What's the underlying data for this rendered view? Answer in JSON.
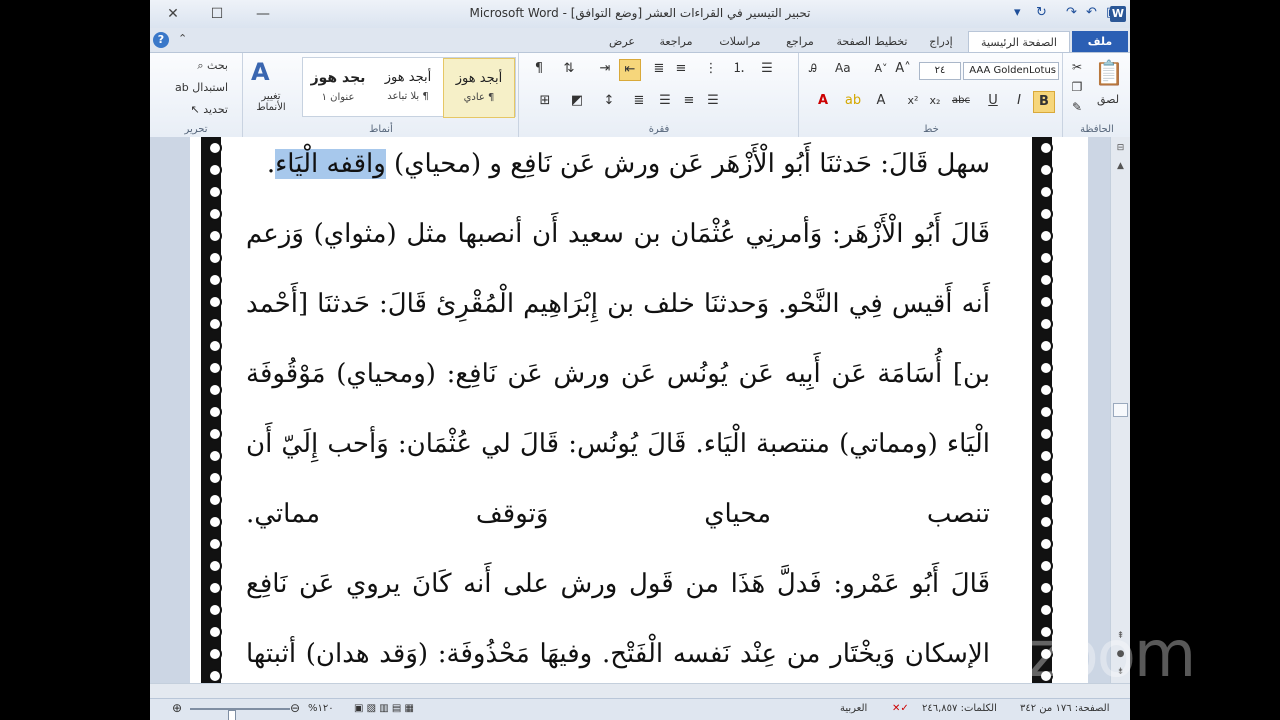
{
  "window": {
    "title": "تحبير التيسير في القراءات العشر [وضع التوافق]  -  Microsoft Word",
    "app_logo": "W"
  },
  "tabs": [
    {
      "label": "ملف",
      "active": false,
      "file": true
    },
    {
      "label": "الصفحة الرئيسية",
      "active": true
    },
    {
      "label": "إدراج"
    },
    {
      "label": "تخطيط الصفحة"
    },
    {
      "label": "مراجع"
    },
    {
      "label": "مراسلات"
    },
    {
      "label": "مراجعة"
    },
    {
      "label": "عرض"
    }
  ],
  "ribbon": {
    "clipboard": {
      "label": "الحافظة",
      "paste": "لصق"
    },
    "font": {
      "label": "خط",
      "font_name": "AAA GoldenLotus",
      "font_size": "٢٤",
      "change_case": "Aa"
    },
    "paragraph": {
      "label": "فقرة"
    },
    "styles": {
      "label": "أنماط",
      "items": [
        {
          "sample": "أبجد هوز",
          "name": "¶ عادي"
        },
        {
          "sample": "أبجد هوز",
          "name": "¶ بلا تباعد"
        },
        {
          "sample": "بجد هوز",
          "name": "عنوان ١"
        }
      ],
      "change_styles": "تغيير الأنماط"
    },
    "editing": {
      "label": "تحرير",
      "find": "بحث",
      "replace": "استبدال",
      "select": "تحديد"
    }
  },
  "document": {
    "lines": [
      {
        "pre": "سهل قَالَ: حَدثنَا أَبُو الْأَزْهَر عَن ورش عَن نَافِع و (محياي) ",
        "hl": "واقفه الْيَاء",
        "post": ".",
        "justify": false
      },
      {
        "text": "قَالَ أَبُو الْأَزْهَر: وَأمرنِي عُثْمَان بن سعيد أَن أنصبها مثل (مثواي) وَزعم",
        "justify": true
      },
      {
        "text": "أَنه أَقيس فِي النَّحْو. وَحدثنَا خلف بن إِبْرَاهِيم الْمُقْرِئ قَالَ: حَدثنَا [أَحْمد",
        "justify": true
      },
      {
        "text": "بن] أُسَامَة عَن أَبِيه عَن يُونُس عَن ورش عَن نَافِع: (ومحياي) مَوْقُوفَة",
        "justify": true
      },
      {
        "text": "الْيَاء (ومماتي) منتصبة الْيَاء. قَالَ يُونُس: قَالَ لي عُثْمَان: وَأحب إِلَيّ أَن",
        "justify": true
      },
      {
        "text": "تنصب محياي وَتوقف مماتي.",
        "justify": true
      },
      {
        "text": "قَالَ أَبُو عَمْرو: فَدلَّ هَذَا من قَول ورش على أَنه كَانَ يروي عَن نَافِع",
        "justify": true
      },
      {
        "text": "الإسكان وَيخْتَار من عِنْد نَفسه الْفَتْح. وفيهَا مَحْذُوفَة: (وَقد هدان) أثبتها",
        "justify": true
      }
    ]
  },
  "statusbar": {
    "page": "الصفحة: ١٧٦ من ٣٤٢",
    "words": "الكلمات: ٢٤٦,٨٥٧",
    "language": "العربية",
    "zoom": "١٢٠%"
  },
  "overlay": {
    "watermark": "zoom"
  }
}
